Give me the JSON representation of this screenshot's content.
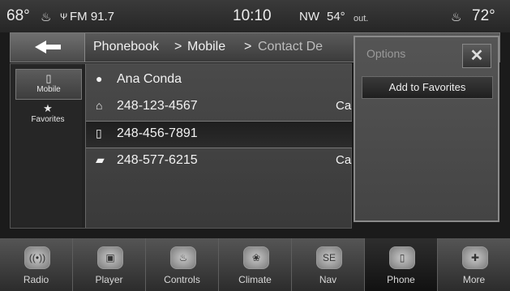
{
  "status_bar": {
    "temp_left": "68°",
    "heat_icon_left": "seat-heat-icon",
    "signal_icon": "antenna-icon",
    "radio_station": "FM 91.7",
    "time": "10:10",
    "direction": "NW",
    "outside_temp": "54°",
    "outside_label": "out.",
    "heat_icon_right": "seat-heat-icon",
    "temp_right": "72°"
  },
  "breadcrumb": {
    "back_icon": "arrow-left-icon",
    "item1": "Phonebook",
    "sep1": ">",
    "item2": "Mobile",
    "sep2": ">",
    "item3": "Contact De"
  },
  "left_tabs": [
    {
      "label": "Mobile",
      "icon": "phone-icon"
    },
    {
      "label": "Favorites",
      "icon": "star-icon"
    }
  ],
  "contact": {
    "name": "Ana Conda",
    "numbers": [
      {
        "icon": "home-icon",
        "number": "248-123-4567",
        "tag": "Ca"
      },
      {
        "icon": "mobile-icon",
        "number": "248-456-7891",
        "tag": ""
      },
      {
        "icon": "work-icon",
        "number": "248-577-6215",
        "tag": "Ca"
      }
    ]
  },
  "options_popup": {
    "title": "Options",
    "close_label": "✕",
    "add_to_favorites": "Add to Favorites"
  },
  "bottom_nav": [
    {
      "label": "Radio",
      "icon": "radio-icon"
    },
    {
      "label": "Player",
      "icon": "player-icon"
    },
    {
      "label": "Controls",
      "icon": "controls-icon"
    },
    {
      "label": "Climate",
      "icon": "climate-icon"
    },
    {
      "label": "Nav",
      "icon": "compass-icon",
      "glyph": "SE"
    },
    {
      "label": "Phone",
      "icon": "phone-icon"
    },
    {
      "label": "More",
      "icon": "plus-icon"
    }
  ]
}
